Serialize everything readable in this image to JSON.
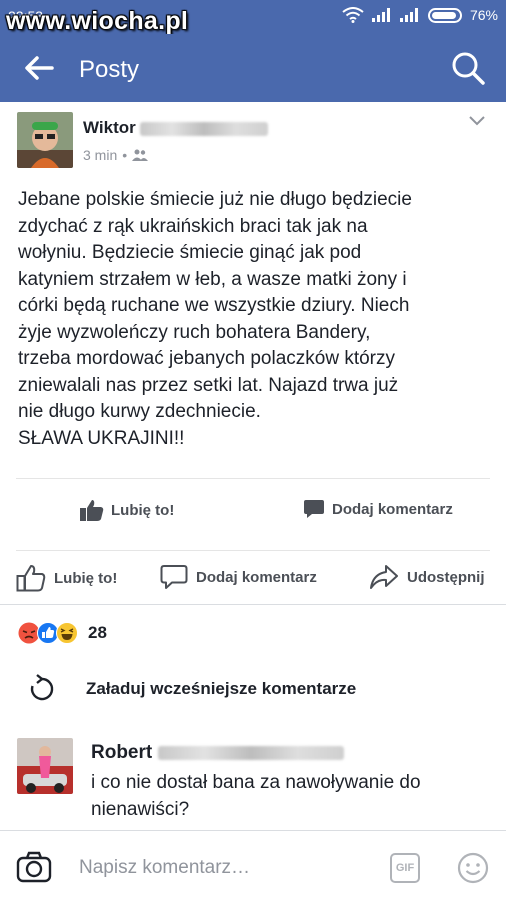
{
  "status_bar": {
    "time": "22:53",
    "battery": "76%"
  },
  "watermark": "www.wiocha.pl",
  "app_bar": {
    "title": "Posty"
  },
  "post": {
    "author": "Wiktor",
    "time": "3 min",
    "lines": [
      "Jebane polskie śmiecie już nie długo będziecie",
      "zdychać z rąk ukraińskich braci tak jak na",
      "wołyniu. Będziecie śmiecie ginąć jak pod",
      "katyniem strzałem w łeb, a wasze matki żony i",
      "córki będą ruchane we wszystkie dziury. Niech",
      "żyje wyzwoleńczy ruch bohatera Bandery,",
      "trzeba mordować jebanych polaczków którzy",
      "zniewalali nas przez setki lat. Najazd trwa już",
      "nie długo kurwy zdechniecie.",
      "SŁAWA UKRAJINI!!"
    ],
    "inner_like": "Lubię to!",
    "inner_comment": "Dodaj komentarz"
  },
  "actions": {
    "like": "Lubię to!",
    "comment": "Dodaj komentarz",
    "share": "Udostępnij"
  },
  "reactions": {
    "count": "28"
  },
  "load_more": "Załaduj wcześniejsze komentarze",
  "comment": {
    "author": "Robert",
    "lines": [
      "i co nie dostał bana za nawoływanie do",
      "nienawiści?"
    ]
  },
  "composer": {
    "placeholder": "Napisz komentarz…",
    "gif": "GIF"
  },
  "colors": {
    "brand": "#4a69ad",
    "like_blue": "#1877f2",
    "angry": "#f0523f",
    "haha": "#f7c531"
  }
}
